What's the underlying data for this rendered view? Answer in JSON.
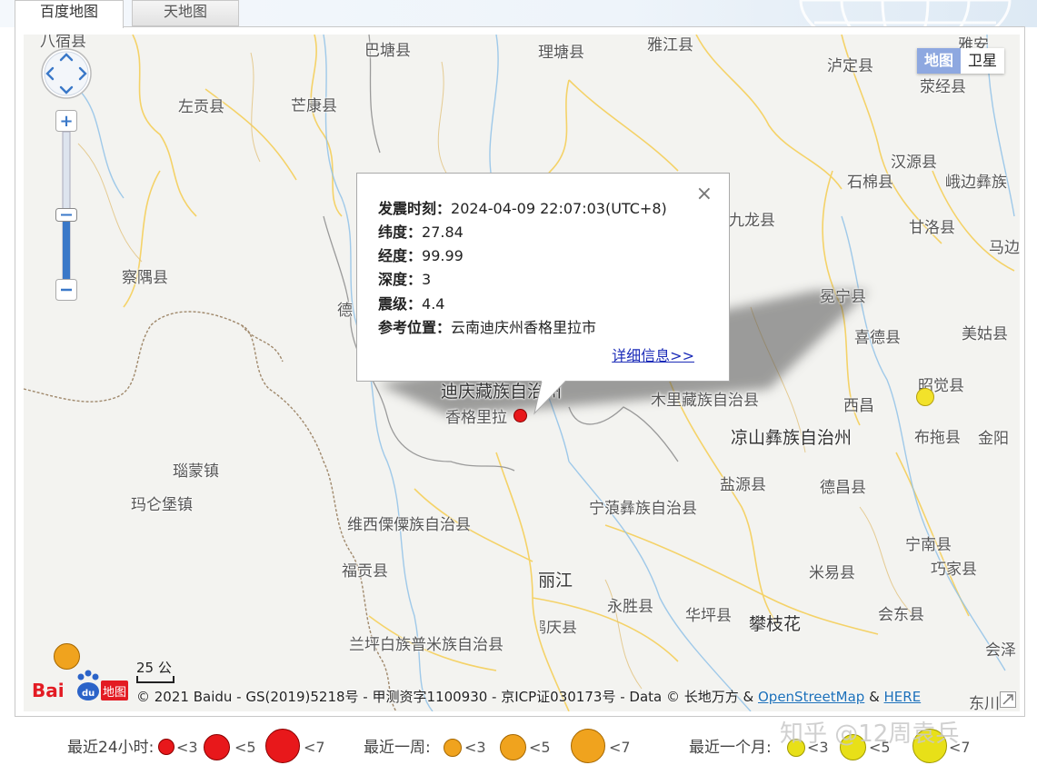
{
  "tabs": [
    {
      "label": "百度地图",
      "active": true
    },
    {
      "label": "天地图",
      "active": false
    }
  ],
  "map_type": {
    "map": "地图",
    "satellite": "卫星",
    "selected": "地图"
  },
  "places": [
    {
      "name": "八宿县"
    },
    {
      "name": "巴塘县"
    },
    {
      "name": "理塘县"
    },
    {
      "name": "雅江县"
    },
    {
      "name": "泸定县"
    },
    {
      "name": "荥经县"
    },
    {
      "name": "雅安"
    },
    {
      "name": "左贡县"
    },
    {
      "name": "芒康县"
    },
    {
      "name": "汉源县"
    },
    {
      "name": "石棉县"
    },
    {
      "name": "峨边彝族"
    },
    {
      "name": "九龙县"
    },
    {
      "name": "甘洛县"
    },
    {
      "name": "马边"
    },
    {
      "name": "察隅县"
    },
    {
      "name": "冕宁县"
    },
    {
      "name": "德"
    },
    {
      "name": "喜德县"
    },
    {
      "name": "美姑县"
    },
    {
      "name": "昭觉县"
    },
    {
      "name": "迪庆藏族自治州"
    },
    {
      "name": "木里藏族自治县"
    },
    {
      "name": "西昌"
    },
    {
      "name": "香格里拉"
    },
    {
      "name": "凉山彝族自治州"
    },
    {
      "name": "布拖县"
    },
    {
      "name": "金阳"
    },
    {
      "name": "瑙蒙镇"
    },
    {
      "name": "盐源县"
    },
    {
      "name": "德昌县"
    },
    {
      "name": "玛仑堡镇"
    },
    {
      "name": "宁蒗彝族自治县"
    },
    {
      "name": "维西傈僳族自治县"
    },
    {
      "name": "宁南县"
    },
    {
      "name": "福贡县"
    },
    {
      "name": "丽江"
    },
    {
      "name": "米易县"
    },
    {
      "name": "巧家县"
    },
    {
      "name": "永胜县"
    },
    {
      "name": "华坪县"
    },
    {
      "name": "会东县"
    },
    {
      "name": "鹤庆县"
    },
    {
      "name": "攀枝花"
    },
    {
      "name": "兰坪白族普米族自治县"
    },
    {
      "name": "会泽"
    },
    {
      "name": "东川"
    }
  ],
  "popup": {
    "rows": [
      {
        "label": "发震时刻：",
        "value": "2024-04-09 22:07:03(UTC+8)"
      },
      {
        "label": "纬度：",
        "value": "27.84"
      },
      {
        "label": "经度：",
        "value": "99.99"
      },
      {
        "label": "深度：",
        "value": "3"
      },
      {
        "label": "震级：",
        "value": "4.4"
      },
      {
        "label": "参考位置：",
        "value": "云南迪庆州香格里拉市"
      }
    ],
    "close": "×",
    "more_link": "详细信息>>"
  },
  "scale_label": "25 公",
  "copyright": {
    "prefix": "© 2021 Baidu - GS(2019)5218号 - 甲测资字1100930 - 京ICP证030173号 - Data © 长地万方 & ",
    "osm": "OpenStreetMap",
    "amp": " & ",
    "here": "HERE"
  },
  "legend": {
    "day_label": "最近24小时:",
    "week_label": "最近一周:",
    "month_label": "最近一个月:",
    "lt3": "<3",
    "lt5": "<5",
    "lt7": "<7",
    "colors": {
      "day": "#e8181b",
      "week": "#f0a31e",
      "month": "#e8e018"
    }
  },
  "watermark": "知乎 @12周袁兵",
  "logo_text": "Bai du 地图"
}
